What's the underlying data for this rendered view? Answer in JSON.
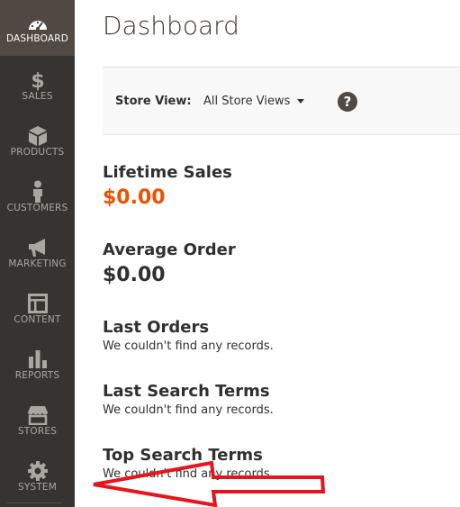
{
  "sidebar": {
    "items": [
      {
        "label": "DASHBOARD",
        "icon": "dashboard-icon",
        "active": true
      },
      {
        "label": "SALES",
        "icon": "dollar-icon"
      },
      {
        "label": "PRODUCTS",
        "icon": "box-icon"
      },
      {
        "label": "CUSTOMERS",
        "icon": "person-icon"
      },
      {
        "label": "MARKETING",
        "icon": "megaphone-icon"
      },
      {
        "label": "CONTENT",
        "icon": "layout-icon"
      },
      {
        "label": "REPORTS",
        "icon": "bar-chart-icon"
      },
      {
        "label": "STORES",
        "icon": "storefront-icon"
      },
      {
        "label": "SYSTEM",
        "icon": "gear-icon"
      }
    ]
  },
  "header": {
    "title": "Dashboard"
  },
  "store_view": {
    "label": "Store View:",
    "selected": "All Store Views",
    "help_glyph": "?"
  },
  "sections": {
    "lifetime_sales": {
      "title": "Lifetime Sales",
      "value": "$0.00",
      "value_color": "#eb5202"
    },
    "average_order": {
      "title": "Average Order",
      "value": "$0.00"
    },
    "last_orders": {
      "title": "Last Orders",
      "text": "We couldn't find any records."
    },
    "last_search_terms": {
      "title": "Last Search Terms",
      "text": "We couldn't find any records."
    },
    "top_search_terms": {
      "title": "Top Search Terms",
      "text": "We couldn't find any records."
    }
  },
  "colors": {
    "sidebar_bg": "#373330",
    "sidebar_active_bg": "#514943",
    "accent": "#eb5202",
    "annotation_arrow": "#e8141c"
  }
}
